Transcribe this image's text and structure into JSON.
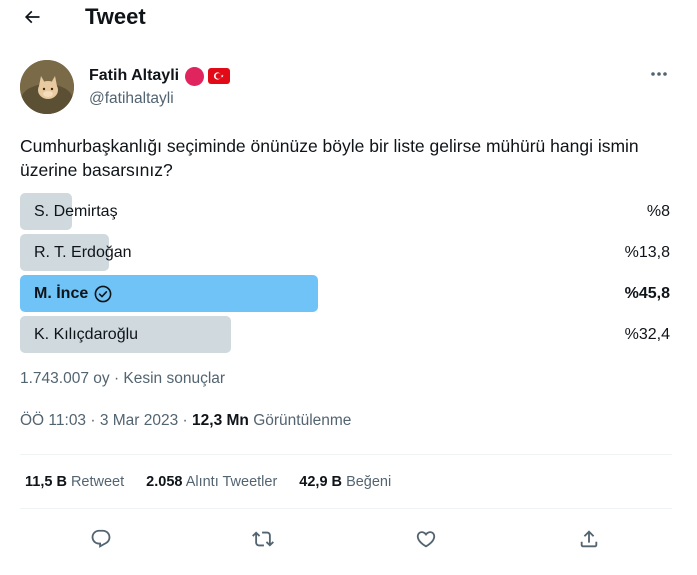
{
  "header": {
    "title": "Tweet",
    "back_icon": "arrow-left-icon"
  },
  "author": {
    "name": "Fatih Altayli",
    "handle": "@fatihaltayli",
    "badges": [
      {
        "icon": "red-circle-icon",
        "color": "#e0245e"
      },
      {
        "icon": "turkey-flag-icon",
        "color": "#e30a17"
      }
    ]
  },
  "tweet": {
    "text": "Cumhurbaşkanlığı seçiminde önünüze böyle bir liste gelirse mühürü hangi ismin üzerine basarsınız?"
  },
  "poll": {
    "options": [
      {
        "label": "S. Demirtaş",
        "percent_text": "%8",
        "share": 0.08,
        "winner": false
      },
      {
        "label": "R. T. Erdoğan",
        "percent_text": "%13,8",
        "share": 0.138,
        "winner": false
      },
      {
        "label": "M. İnce",
        "percent_text": "%45,8",
        "share": 0.458,
        "winner": true
      },
      {
        "label": "K. Kılıçdaroğlu",
        "percent_text": "%32,4",
        "share": 0.324,
        "winner": false
      }
    ],
    "meta": "1.743.007 oy · Kesin sonuçlar",
    "colors": {
      "bar": "#cfd9de",
      "winner_bar": "#6fc3f7"
    }
  },
  "timestamp": {
    "time_date": "ÖÖ 11:03 · 3 Mar 2023 · ",
    "views_count": "12,3 Mn",
    "views_label": "Görüntülenme"
  },
  "stats": {
    "retweets_count": "11,5 B",
    "retweets_label": "Retweet",
    "quotes_count": "2.058",
    "quotes_label": "Alıntı Tweetler",
    "likes_count": "42,9 B",
    "likes_label": "Beğeni"
  },
  "actions": [
    "reply-icon",
    "retweet-icon",
    "like-icon",
    "share-icon"
  ]
}
